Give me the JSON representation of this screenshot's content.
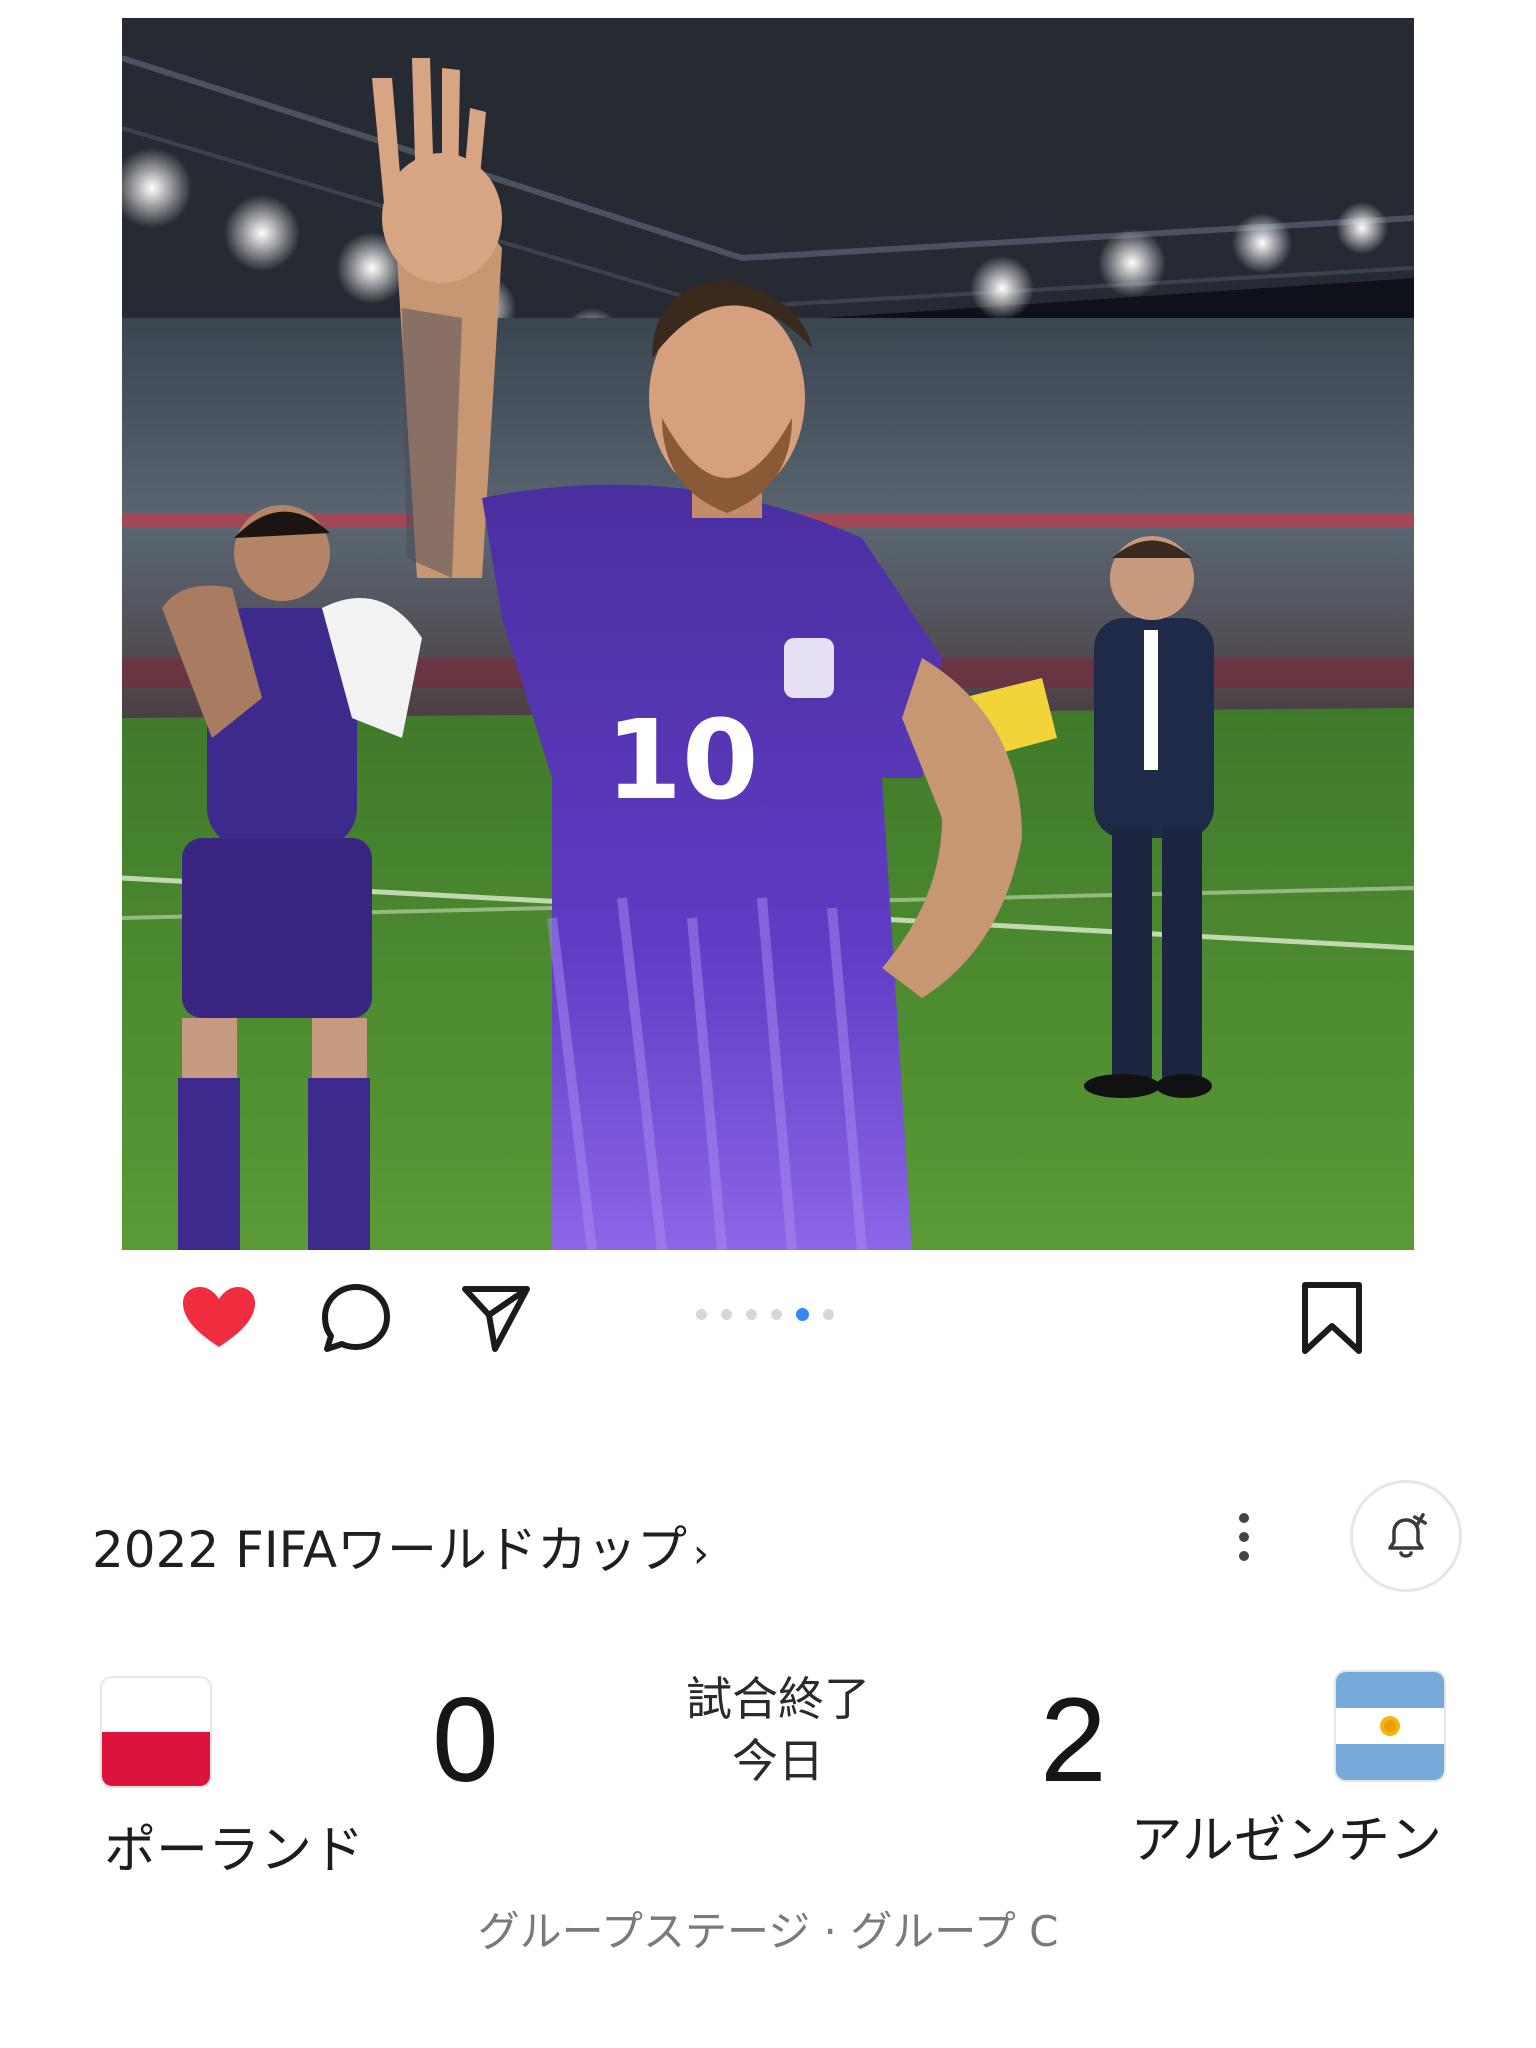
{
  "post": {
    "image_alt": "",
    "carousel": {
      "count": 6,
      "active_index": 4
    },
    "liked": true,
    "colors": {
      "like": "#f02d3f",
      "carousel_active": "#2f8bf2",
      "carousel_inactive": "#d7d7d7"
    },
    "icons": [
      "heart-icon",
      "comment-bubble-icon",
      "send-arrow-icon",
      "bookmark-icon"
    ]
  },
  "match": {
    "competition": "2022 FIFAワールドカップ",
    "competition_chevron": "›",
    "home": {
      "name": "ポーランド",
      "score": "0",
      "flag": "poland-flag"
    },
    "away": {
      "name": "アルゼンチン",
      "score": "2",
      "flag": "argentina-flag"
    },
    "status_line1": "試合終了",
    "status_line2": "今日",
    "stage": "グループステージ · グループ C",
    "icons": [
      "more-vertical-icon",
      "bell-plus-icon"
    ]
  }
}
